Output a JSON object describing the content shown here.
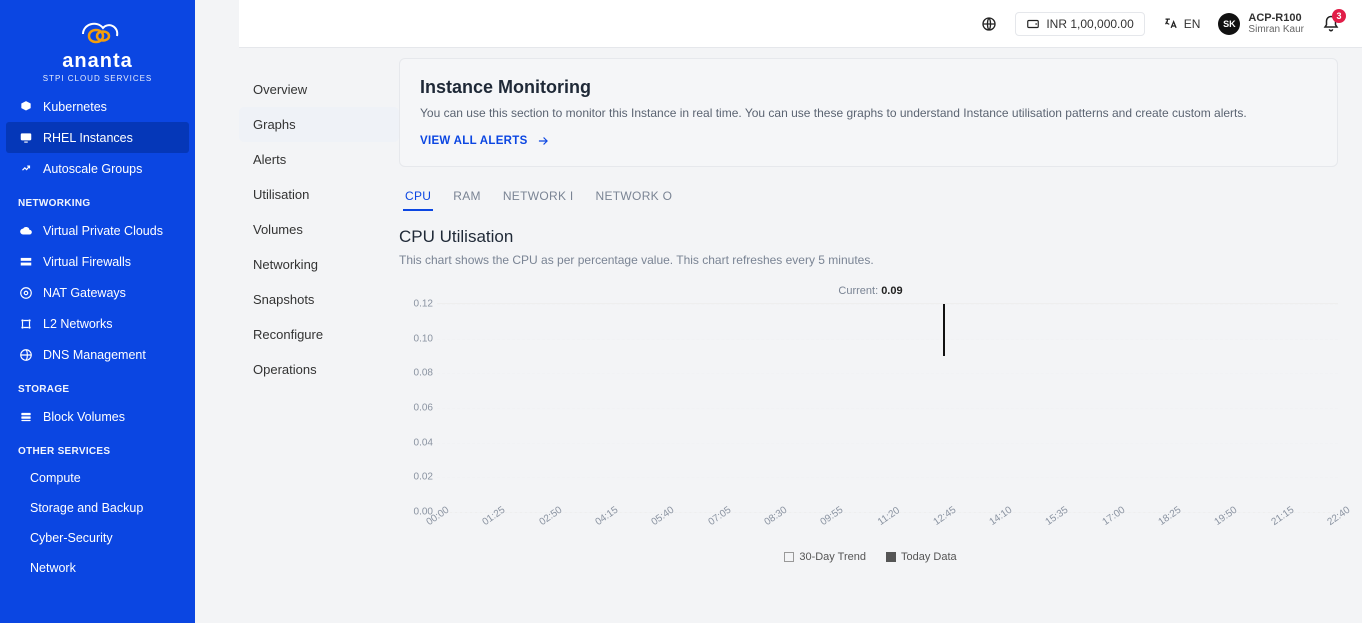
{
  "brand": {
    "name": "ananta",
    "sub": "STPI CLOUD SERVICES"
  },
  "sidebar": {
    "items": [
      {
        "icon": "kubernetes-icon",
        "label": "Kubernetes"
      },
      {
        "icon": "rhel-icon",
        "label": "RHEL Instances",
        "active": true
      },
      {
        "icon": "autoscale-icon",
        "label": "Autoscale Groups"
      }
    ],
    "sections": [
      {
        "title": "NETWORKING",
        "items": [
          {
            "icon": "cloud-icon",
            "label": "Virtual Private Clouds"
          },
          {
            "icon": "firewall-icon",
            "label": "Virtual Firewalls"
          },
          {
            "icon": "nat-icon",
            "label": "NAT Gateways"
          },
          {
            "icon": "l2-icon",
            "label": "L2 Networks"
          },
          {
            "icon": "dns-icon",
            "label": "DNS Management"
          }
        ]
      },
      {
        "title": "STORAGE",
        "items": [
          {
            "icon": "volume-icon",
            "label": "Block Volumes"
          }
        ]
      },
      {
        "title": "OTHER SERVICES",
        "items": [
          {
            "label": "Compute"
          },
          {
            "label": "Storage and Backup"
          },
          {
            "label": "Cyber-Security"
          },
          {
            "label": "Network"
          }
        ],
        "plain": true
      }
    ]
  },
  "topbar": {
    "balance": "INR 1,00,000.00",
    "lang": "EN",
    "avatar_initials": "SK",
    "org": "ACP-R100",
    "user": "Simran Kaur",
    "notifications": "3"
  },
  "subnav": {
    "items": [
      "Overview",
      "Graphs",
      "Alerts",
      "Utilisation",
      "Volumes",
      "Networking",
      "Snapshots",
      "Reconfigure",
      "Operations"
    ],
    "selected": "Graphs"
  },
  "infobox": {
    "title": "Instance Monitoring",
    "body": "You can use this section to monitor this Instance in real time. You can use these graphs to understand Instance utilisation patterns and create custom alerts.",
    "link": "VIEW ALL ALERTS"
  },
  "tabs": {
    "items": [
      "CPU",
      "RAM",
      "NETWORK I",
      "NETWORK O"
    ],
    "selected": "CPU"
  },
  "chart": {
    "title": "CPU Utilisation",
    "sub": "This chart shows the CPU as per percentage value. This chart refreshes every 5 minutes.",
    "current_label": "Current: ",
    "legend": {
      "trend": "30-Day Trend",
      "today": "Today Data"
    }
  },
  "chart_data": {
    "type": "line",
    "title": "CPU Utilisation",
    "xlabel": "",
    "ylabel": "",
    "ylim": [
      0,
      0.12
    ],
    "y_ticks": [
      0.0,
      0.02,
      0.04,
      0.06,
      0.08,
      0.1,
      0.12
    ],
    "categories": [
      "00:00",
      "01:25",
      "02:50",
      "04:15",
      "05:40",
      "07:05",
      "08:30",
      "09:55",
      "11:20",
      "12:45",
      "14:10",
      "15:35",
      "17:00",
      "18:25",
      "19:50",
      "21:15",
      "22:40"
    ],
    "series": [
      {
        "name": "30-Day Trend",
        "values": [
          null,
          null,
          null,
          null,
          null,
          null,
          null,
          null,
          null,
          null,
          null,
          null,
          null,
          null,
          null,
          null,
          null
        ]
      },
      {
        "name": "Today Data",
        "values": [
          null,
          null,
          null,
          null,
          null,
          null,
          null,
          null,
          null,
          0.12,
          null,
          null,
          null,
          null,
          null,
          null,
          null
        ]
      }
    ],
    "current": 0.09
  }
}
